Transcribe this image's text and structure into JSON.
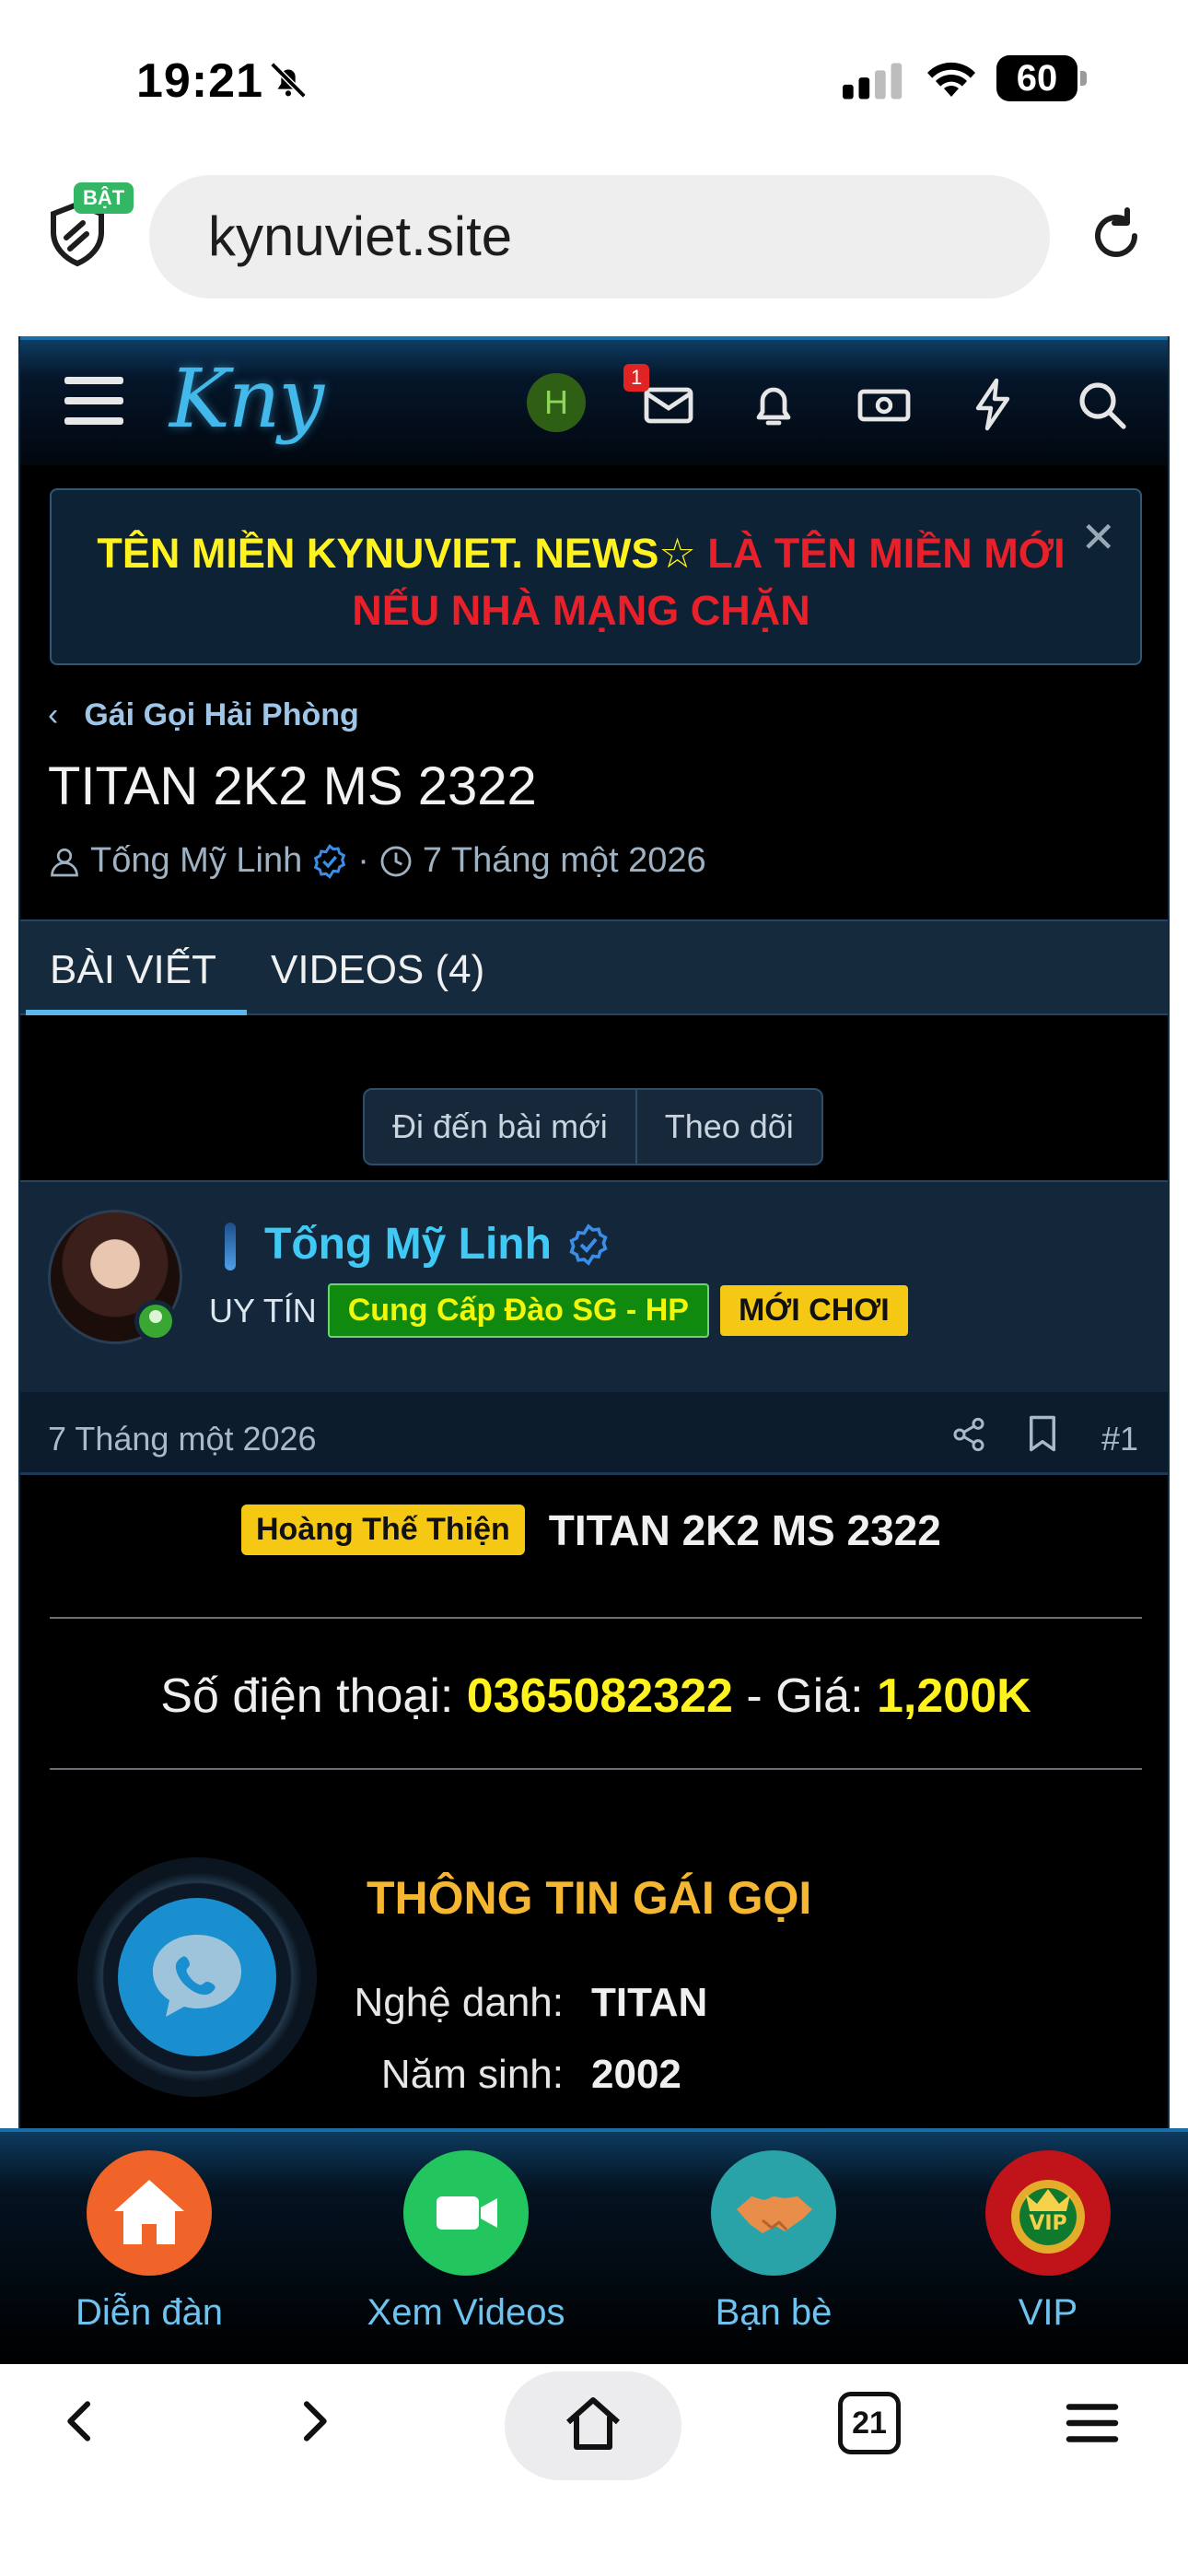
{
  "status_bar": {
    "time": "19:21",
    "battery": "60"
  },
  "browser": {
    "url": "kynuviet.site",
    "shield_badge": "BẬT",
    "tab_count": "21"
  },
  "site": {
    "logo_text": "Kny",
    "user_initial": "H",
    "inbox_count": "1",
    "notice": {
      "part_yellow": "TÊN MIỀN KYNUVIET. NEWS☆",
      "part_red": " LÀ TÊN MIỀN MỚI NẾU NHÀ MẠNG CHẶN",
      "close": "✕"
    },
    "breadcrumb": "Gái Gọi Hải Phòng",
    "thread_title": "TITAN 2K2 MS 2322",
    "meta_author": "Tống Mỹ Linh",
    "meta_date": "7 Tháng một 2026",
    "tabs": [
      {
        "label": "BÀI VIẾT"
      },
      {
        "label": "VIDEOS (4)"
      }
    ],
    "buttons": {
      "goto_new": "Đi đến bài mới",
      "follow": "Theo dõi"
    },
    "post": {
      "username": "Tống Mỹ Linh",
      "role_label": "UY TÍN",
      "tag_green": "Cung Cấp Đào SG - HP",
      "tag_yellow": "MỚI CHƠI",
      "date": "7 Tháng một 2026",
      "number": "#1",
      "prefix": "Hoàng Thế Thiện",
      "title": "TITAN 2K2 MS 2322",
      "phone_label": "Số điện thoại: ",
      "phone": "0365082322",
      "price_label": " - Giá: ",
      "price": "1,200K",
      "info_title": "THÔNG TIN GÁI GỌI",
      "info": [
        {
          "label": "Nghệ danh:",
          "value": "TITAN"
        },
        {
          "label": "Năm sinh:",
          "value": "2002"
        }
      ]
    },
    "bottom_nav": [
      {
        "label": "Diễn đàn",
        "icon": "home-icon",
        "color": "#f0642a"
      },
      {
        "label": "Xem Videos",
        "icon": "video-camera-icon",
        "color": "#22c55e"
      },
      {
        "label": "Bạn bè",
        "icon": "handshake-icon",
        "color": "#2aa3a8"
      },
      {
        "label": "VIP",
        "icon": "vip-crown-icon",
        "color": "#c0141a"
      }
    ]
  }
}
